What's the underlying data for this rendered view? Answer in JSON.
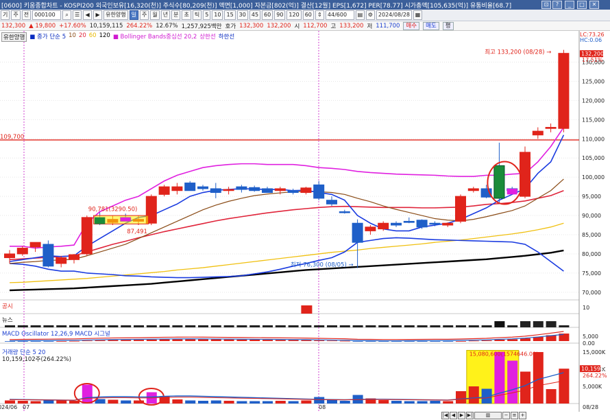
{
  "titlebar": {
    "text": "[0600] 키움종합차트 - KOSPI200 외국인보유[16,320(천)] 주식수[80,209(천)] 액면[1,000] 자본금[802(억)] 결산[12월] EPS[1,672] PER[78.77] 시가총액[105,635(억)] 유통비율[68.7]",
    "buttons": [
      "⊡",
      "?",
      "_",
      "□",
      "✕"
    ]
  },
  "toolbar": {
    "items": [
      "기",
      "주",
      "전"
    ],
    "code_value": "000100",
    "stock_name": "유한양행",
    "periods": [
      "일",
      "주",
      "월",
      "년",
      "분",
      "초",
      "틱"
    ],
    "minutes": [
      "5",
      "10",
      "15",
      "30",
      "45",
      "60",
      "90",
      "120",
      "60"
    ],
    "count_display": "44/600",
    "date_value": "2024/08/28"
  },
  "infobar": {
    "price": "132,300",
    "change": "▲ 19,800",
    "change_pct": "+17.60%",
    "volume": "10,159,115",
    "vol_pct": "264.22%",
    "turnover": "12.67%",
    "amount": "1,257,925백만",
    "ask_label": "호가",
    "ask": "132,300",
    "bid": "132,200",
    "open_label": "시",
    "open": "112,700",
    "high_label": "고",
    "high": "133,200",
    "low_label": "저",
    "low": "111,700",
    "buy_btn": "매수",
    "sell_btn": "매도",
    "avg_btn": "평"
  },
  "legend": {
    "name": "유한양행",
    "ma_title": "■ 종가 단순 5",
    "ma10": "10",
    "ma20": "20",
    "ma60": "60",
    "ma120": "120",
    "bb": "■ Bollinger Bands중심선 20,2",
    "bb_up": "상한선",
    "bb_low": "하한선"
  },
  "annotations": {
    "high_label": "최고 133,200 (08/28)",
    "low_label": "최저 76,300 (08/05)",
    "range_label": "90,781(3290.50)",
    "sub_label": "87,491",
    "line_price": "109,700"
  },
  "right_axis": {
    "lc": "LC:73.26",
    "hc": "HC:0.06",
    "last": "132,200",
    "pct": "17.51%",
    "ticks": [
      "130,000",
      "125,000",
      "120,000",
      "115,000",
      "110,000",
      "105,000",
      "100,000",
      "95,000",
      "90,000",
      "85,000",
      "80,000",
      "75,000",
      "70,000"
    ]
  },
  "panes": {
    "disclosure": "공시",
    "disclosure_tick": "10",
    "news": "뉴스",
    "macd": "MACD Oscillator 12,26,9   MACD  시그널",
    "macd_ticks": [
      "5,000",
      "0.00"
    ],
    "volume_title": "거래량 단순 5  20",
    "volume_sub": "10,159,102주(264.22%)",
    "volume_annot": "15,080,600(1574646.00)",
    "volume_ticks": [
      "15,000K",
      "10,000K",
      "5,000K"
    ],
    "volume_last": "10,159K",
    "volume_pct": "264.22%"
  },
  "x_axis": [
    "2024/06",
    "07",
    "08",
    "08/28"
  ],
  "chart_data": {
    "type": "candlestick",
    "ylim": [
      68000,
      136000
    ],
    "candles": [
      {
        "o": 79000,
        "h": 81000,
        "l": 77500,
        "c": 80000
      },
      {
        "o": 80000,
        "h": 82000,
        "l": 79500,
        "c": 81500
      },
      {
        "o": 81800,
        "h": 83000,
        "l": 80500,
        "c": 83000
      },
      {
        "o": 82500,
        "h": 83500,
        "l": 76500,
        "c": 76800
      },
      {
        "o": 77500,
        "h": 79500,
        "l": 76500,
        "c": 79000
      },
      {
        "o": 78500,
        "h": 80000,
        "l": 77500,
        "c": 79800
      },
      {
        "o": 80000,
        "h": 90000,
        "l": 79500,
        "c": 89500
      },
      {
        "o": 89500,
        "h": 90800,
        "l": 87500,
        "c": 87800
      },
      {
        "o": 88200,
        "h": 90000,
        "l": 87500,
        "c": 89000
      },
      {
        "o": 89500,
        "h": 90500,
        "l": 88500,
        "c": 88500
      },
      {
        "o": 88500,
        "h": 90000,
        "l": 87500,
        "c": 89000
      },
      {
        "o": 88000,
        "h": 95500,
        "l": 87500,
        "c": 95000
      },
      {
        "o": 95500,
        "h": 98000,
        "l": 95000,
        "c": 97500
      },
      {
        "o": 96500,
        "h": 98500,
        "l": 95500,
        "c": 97500
      },
      {
        "o": 98500,
        "h": 99000,
        "l": 96500,
        "c": 96500
      },
      {
        "o": 97500,
        "h": 98000,
        "l": 96500,
        "c": 97000
      },
      {
        "o": 97000,
        "h": 98500,
        "l": 94500,
        "c": 96000
      },
      {
        "o": 96500,
        "h": 97500,
        "l": 95500,
        "c": 96800
      },
      {
        "o": 97500,
        "h": 98000,
        "l": 96000,
        "c": 96800
      },
      {
        "o": 97300,
        "h": 97800,
        "l": 96200,
        "c": 96500
      },
      {
        "o": 97000,
        "h": 97500,
        "l": 96000,
        "c": 96000
      },
      {
        "o": 96500,
        "h": 97500,
        "l": 95500,
        "c": 97000
      },
      {
        "o": 96500,
        "h": 97000,
        "l": 95500,
        "c": 96000
      },
      {
        "o": 96000,
        "h": 97500,
        "l": 95500,
        "c": 97200
      },
      {
        "o": 98000,
        "h": 99000,
        "l": 94000,
        "c": 94500
      },
      {
        "o": 94000,
        "h": 95000,
        "l": 92500,
        "c": 93000
      },
      {
        "o": 91000,
        "h": 91500,
        "l": 90500,
        "c": 90800
      },
      {
        "o": 88000,
        "h": 89000,
        "l": 76300,
        "c": 83000
      },
      {
        "o": 86000,
        "h": 87500,
        "l": 85000,
        "c": 87000
      },
      {
        "o": 86500,
        "h": 88500,
        "l": 86000,
        "c": 88000
      },
      {
        "o": 88000,
        "h": 88500,
        "l": 87000,
        "c": 87500
      },
      {
        "o": 88500,
        "h": 89500,
        "l": 88000,
        "c": 88200
      },
      {
        "o": 88800,
        "h": 89000,
        "l": 86500,
        "c": 87000
      },
      {
        "o": 88000,
        "h": 88500,
        "l": 87200,
        "c": 87800
      },
      {
        "o": 87500,
        "h": 88200,
        "l": 87000,
        "c": 88000
      },
      {
        "o": 88500,
        "h": 95500,
        "l": 88000,
        "c": 95000
      },
      {
        "o": 96500,
        "h": 97500,
        "l": 96000,
        "c": 97000
      },
      {
        "o": 97000,
        "h": 98000,
        "l": 94500,
        "c": 94800
      },
      {
        "o": 103000,
        "h": 109000,
        "l": 93000,
        "c": 94500
      },
      {
        "o": 97000,
        "h": 97500,
        "l": 95500,
        "c": 96500
      },
      {
        "o": 95000,
        "h": 108000,
        "l": 94500,
        "c": 106500
      },
      {
        "o": 111000,
        "h": 113000,
        "l": 110000,
        "c": 112000
      },
      {
        "o": 112700,
        "h": 114000,
        "l": 111700,
        "c": 113000
      },
      {
        "o": 112700,
        "h": 133200,
        "l": 111700,
        "c": 132300
      }
    ],
    "bb_upper": [
      82000,
      82000,
      81500,
      81800,
      82000,
      82300,
      88000,
      91000,
      92500,
      94000,
      95000,
      97000,
      99000,
      100500,
      101500,
      102500,
      103000,
      103300,
      103500,
      103500,
      103300,
      103300,
      103300,
      103000,
      102500,
      102300,
      102000,
      101500,
      101200,
      101000,
      100800,
      100700,
      100600,
      100500,
      100300,
      100200,
      100200,
      100500,
      100500,
      100800,
      101000,
      104000,
      108000,
      113000
    ],
    "bb_mid": [
      78500,
      78700,
      78900,
      79100,
      79300,
      79500,
      80500,
      81500,
      82500,
      83300,
      84200,
      85000,
      85800,
      86500,
      87200,
      87900,
      88600,
      89200,
      89700,
      90200,
      90700,
      91100,
      91500,
      91800,
      92100,
      92300,
      92400,
      92300,
      92200,
      92100,
      92100,
      92100,
      92000,
      92000,
      92100,
      92200,
      92500,
      92900,
      93100,
      93400,
      93800,
      94500,
      95200,
      96500
    ],
    "bb_lower": [
      77500,
      77300,
      76800,
      76000,
      75500,
      75500,
      75000,
      74800,
      74600,
      74300,
      74200,
      74000,
      73900,
      73800,
      73800,
      73900,
      74000,
      74100,
      74300,
      74800,
      75300,
      76000,
      76800,
      77500,
      78300,
      79000,
      80500,
      83000,
      83500,
      84000,
      84200,
      84100,
      83900,
      83700,
      83600,
      83500,
      83400,
      83300,
      83200,
      83100,
      82500,
      80500,
      78000,
      75500
    ],
    "ma5": [
      78000,
      78500,
      79000,
      79500,
      79300,
      79500,
      82000,
      84000,
      86000,
      88000,
      89500,
      90000,
      91500,
      93000,
      95000,
      96000,
      96600,
      96800,
      97000,
      96900,
      96800,
      96800,
      96500,
      96600,
      96000,
      95500,
      94000,
      90000,
      88000,
      86500,
      86000,
      86000,
      87000,
      87500,
      88000,
      89000,
      90500,
      92000,
      94000,
      95500,
      97000,
      101000,
      104000,
      111000
    ],
    "ma10": [
      77500,
      77800,
      78000,
      78300,
      78400,
      78600,
      79500,
      80500,
      81500,
      82500,
      84000,
      85500,
      87000,
      88500,
      90000,
      91500,
      92700,
      93700,
      94500,
      95200,
      95600,
      95900,
      96200,
      96300,
      96200,
      96000,
      95500,
      94500,
      93600,
      92500,
      91600,
      90800,
      90000,
      89200,
      88800,
      88600,
      89000,
      89700,
      90500,
      91300,
      92500,
      94500,
      96500,
      99500
    ],
    "ma20": [
      77000,
      77200,
      77400,
      77600,
      77800,
      78000,
      78500,
      79000,
      79800,
      80600,
      81500,
      82300,
      83200,
      84000,
      84800,
      85600,
      86300,
      87000,
      87700,
      88300,
      88900,
      89500,
      90100,
      90600,
      91000,
      91300,
      91500,
      91600,
      91600,
      91600,
      91700,
      91800,
      91900,
      92000,
      92100,
      92200,
      92400,
      92600,
      92800,
      93000,
      93300,
      93700,
      94200,
      95000
    ],
    "ma60": [
      72500,
      72600,
      72800,
      73000,
      73200,
      73400,
      73600,
      73900,
      74200,
      74500,
      74800,
      75100,
      75400,
      75800,
      76100,
      76400,
      76800,
      77200,
      77600,
      78000,
      78400,
      78800,
      79200,
      79600,
      80000,
      80400,
      80700,
      81000,
      81400,
      81700,
      82000,
      82300,
      82600,
      83000,
      83300,
      83600,
      84000,
      84400,
      84800,
      85200,
      85700,
      86300,
      87000,
      88000
    ],
    "ma120": [
      70500,
      70600,
      70700,
      70800,
      70900,
      71000,
      71200,
      71400,
      71600,
      71800,
      72000,
      72200,
      72500,
      72800,
      73100,
      73400,
      73700,
      74000,
      74300,
      74600,
      74900,
      75200,
      75500,
      75800,
      76000,
      76200,
      76400,
      76600,
      76800,
      77000,
      77200,
      77400,
      77600,
      77800,
      78000,
      78200,
      78400,
      78600,
      78900,
      79200,
      79500,
      79900,
      80300,
      80900
    ],
    "volume": [
      900,
      800,
      700,
      1000,
      900,
      800,
      5500,
      1300,
      1100,
      900,
      900,
      3300,
      2000,
      1200,
      900,
      800,
      900,
      800,
      700,
      700,
      700,
      800,
      700,
      900,
      1900,
      1200,
      800,
      2500,
      1500,
      1000,
      800,
      700,
      700,
      800,
      700,
      3600,
      5000,
      4300,
      15080,
      12500,
      9300,
      15000,
      4200,
      10159
    ],
    "vol_ma": [
      1200,
      1150,
      1100,
      1050,
      1000,
      950,
      1700,
      1900,
      2000,
      2000,
      1900,
      1900,
      2100,
      2200,
      2200,
      2100,
      2000,
      1900,
      1800,
      1700,
      1600,
      1500,
      1400,
      1300,
      1200,
      1150,
      1100,
      1200,
      1250,
      1250,
      1200,
      1150,
      1100,
      1050,
      1000,
      1300,
      1600,
      1900,
      3000,
      4000,
      5200,
      7000,
      8000,
      9000
    ],
    "macd_hist": [
      -200,
      -150,
      -100,
      -50,
      0,
      50,
      200,
      350,
      450,
      500,
      550,
      650,
      750,
      800,
      820,
      800,
      750,
      700,
      650,
      600,
      550,
      500,
      450,
      400,
      300,
      200,
      100,
      -100,
      -150,
      -200,
      -200,
      -180,
      -150,
      -120,
      -100,
      0,
      150,
      300,
      600,
      800,
      1200,
      1800,
      2500,
      3200
    ]
  }
}
